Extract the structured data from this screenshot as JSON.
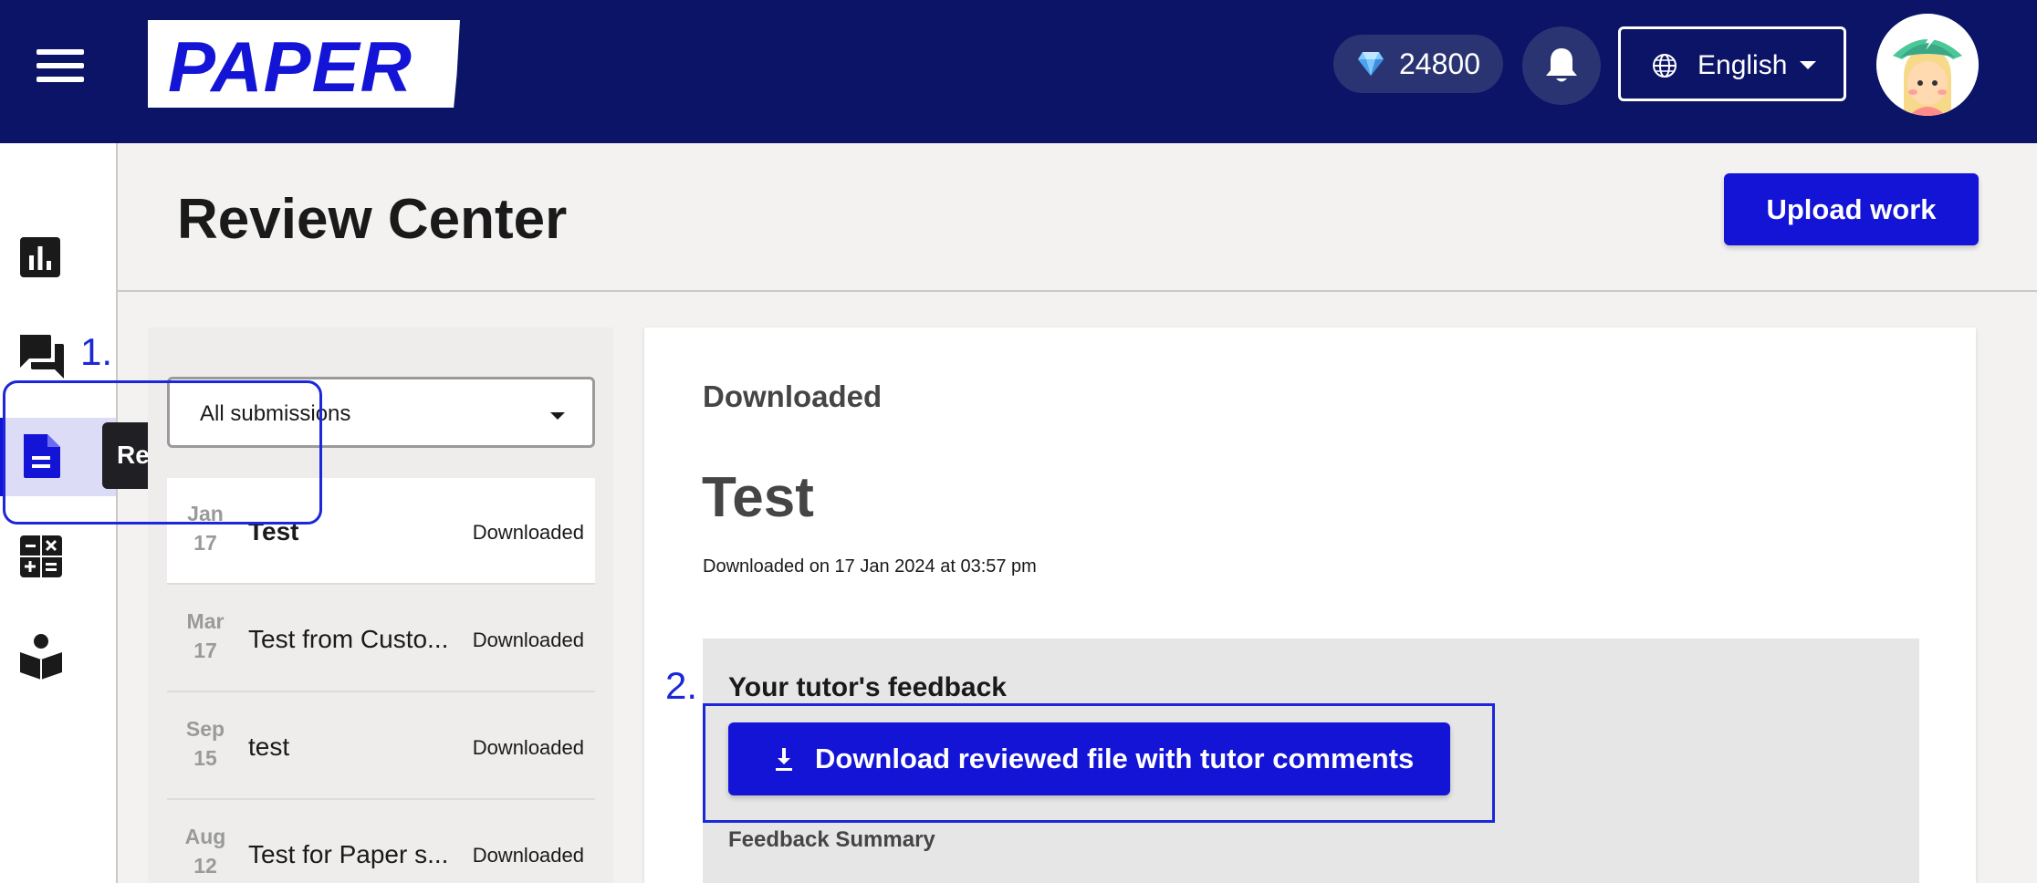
{
  "topbar": {
    "logo_text": "PAPER",
    "gem_count": "24800",
    "language": "English",
    "colors": {
      "background": "#0b1466",
      "accent": "#1414d6"
    },
    "icons": [
      "menu-icon",
      "gem-icon",
      "bell-icon",
      "globe-icon",
      "chevron-down-icon",
      "avatar"
    ]
  },
  "sidebar": {
    "items": [
      {
        "icon": "bar-chart-icon",
        "label": "Dashboard"
      },
      {
        "icon": "chat-icon",
        "label": "Chat"
      },
      {
        "icon": "document-icon",
        "label": "Review Center",
        "active": true
      },
      {
        "icon": "calculator-icon",
        "label": "Math"
      },
      {
        "icon": "reader-icon",
        "label": "Reading"
      }
    ],
    "tooltip": "Review Center"
  },
  "annotations": {
    "step1": "1.",
    "step2": "2."
  },
  "header": {
    "title": "Review Center",
    "upload_label": "Upload work"
  },
  "submissions": {
    "filter": "All submissions",
    "items": [
      {
        "month": "Jan",
        "day": "17",
        "title": "Test",
        "status": "Downloaded",
        "selected": true
      },
      {
        "month": "Mar",
        "day": "17",
        "title": "Test from Custo...",
        "status": "Downloaded"
      },
      {
        "month": "Sep",
        "day": "15",
        "title": "test",
        "status": "Downloaded"
      },
      {
        "month": "Aug",
        "day": "12",
        "title": "Test for Paper s...",
        "status": "Downloaded"
      }
    ]
  },
  "detail": {
    "status": "Downloaded",
    "title": "Test",
    "date_text": "Downloaded on 17 Jan 2024 at 03:57 pm",
    "feedback_heading": "Your tutor's feedback",
    "download_label": "Download reviewed file with tutor comments",
    "summary_label": "Feedback Summary"
  }
}
